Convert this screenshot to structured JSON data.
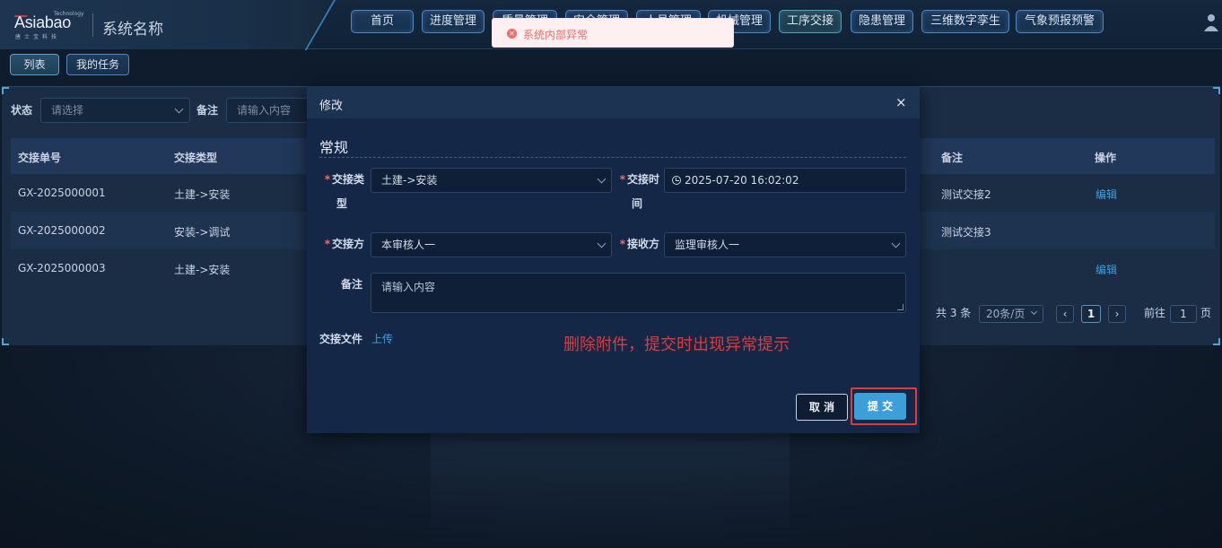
{
  "header": {
    "logo_word": "Asiabao",
    "logo_tech": "Technology",
    "logo_sub": "唐士宝科技",
    "system_name": "系统名称",
    "nav": [
      {
        "label": "首页"
      },
      {
        "label": "进度管理"
      },
      {
        "label": "质量管理"
      },
      {
        "label": "安全管理"
      },
      {
        "label": "人员管理"
      },
      {
        "label": "机械管理"
      },
      {
        "label": "工序交接"
      },
      {
        "label": "隐患管理"
      },
      {
        "label": "三维数字孪生"
      },
      {
        "label": "气象预报预警"
      }
    ]
  },
  "toast": {
    "message": "系统内部异常"
  },
  "subtabs": [
    {
      "label": "列表"
    },
    {
      "label": "我的任务"
    }
  ],
  "filters": {
    "status_label": "状态",
    "status_placeholder": "请选择",
    "remark_label": "备注",
    "remark_placeholder": "请输入内容"
  },
  "table": {
    "headers": {
      "no": "交接单号",
      "type": "交接类型",
      "remark": "备注",
      "action": "操作"
    },
    "rows": [
      {
        "no": "GX-2025000001",
        "type": "土建->安装",
        "remark": "测试交接2",
        "action": "编辑"
      },
      {
        "no": "GX-2025000002",
        "type": "安装->调试",
        "remark": "测试交接3",
        "action": ""
      },
      {
        "no": "GX-2025000003",
        "type": "土建->安装",
        "remark": "",
        "action": "编辑"
      }
    ]
  },
  "pager": {
    "total": "共 3 条",
    "page_size": "20条/页",
    "current": "1",
    "goto_prefix": "前往",
    "goto_value": "1",
    "goto_suffix": "页"
  },
  "modal": {
    "title": "修改",
    "close": "×",
    "section": "常规",
    "labels": {
      "type_line1": "交接类",
      "type_line2": "型",
      "time_line1": "交接时",
      "time_line2": "间",
      "from": "交接方",
      "to": "接收方",
      "remark": "备注",
      "files": "交接文件"
    },
    "values": {
      "type": "土建->安装",
      "time": "2025-07-20 16:02:02",
      "from": "本审核人一",
      "to": "监理审核人一",
      "remark_placeholder": "请输入内容",
      "upload": "上传"
    },
    "annotation": "删除附件，提交时出现异常提示",
    "cancel": "取 消",
    "submit": "提 交"
  },
  "colors": {
    "accent": "#3c9fd8",
    "error": "#f56c6c",
    "annotation": "#e03b3b"
  }
}
